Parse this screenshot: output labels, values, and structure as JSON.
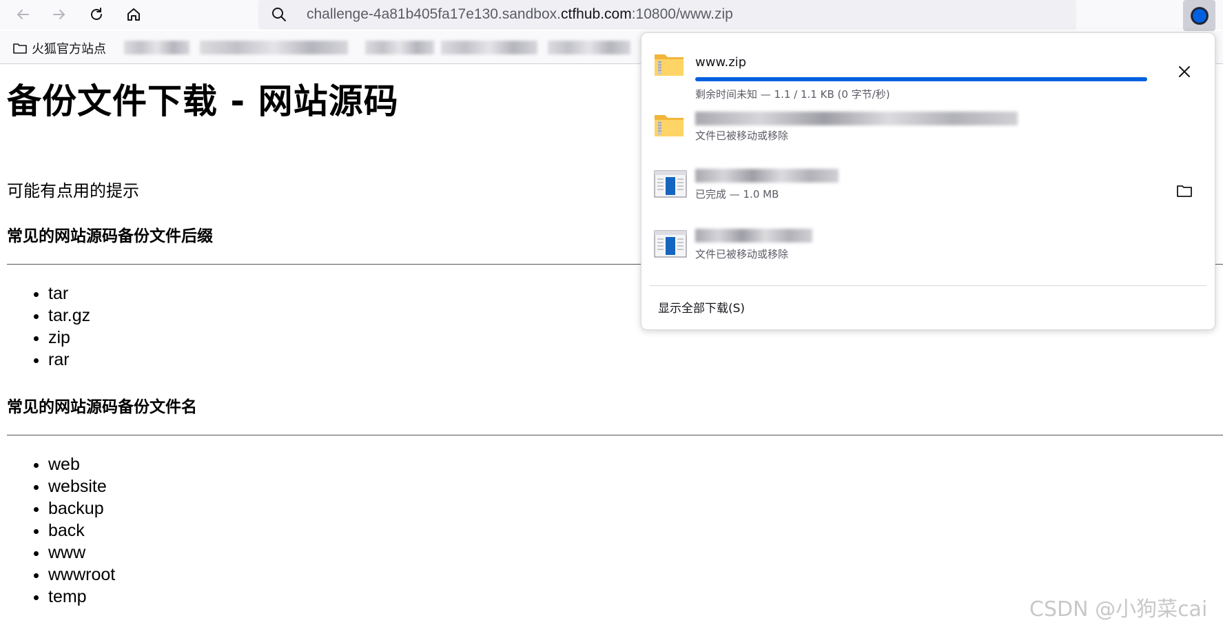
{
  "browser": {
    "url_prefix": "challenge-4a81b405fa17e130.sandbox.",
    "url_domain": "ctfhub.com",
    "url_suffix": ":10800/www.zip",
    "bookmark_folder_label": "火狐官方站点"
  },
  "page": {
    "title": "备份文件下载 - 网站源码",
    "hint": "可能有点用的提示",
    "section1_title": "常见的网站源码备份文件后缀",
    "suffixes": [
      "tar",
      "tar.gz",
      "zip",
      "rar"
    ],
    "section2_title": "常见的网站源码备份文件名",
    "names": [
      "web",
      "website",
      "backup",
      "back",
      "www",
      "wwwroot",
      "temp"
    ]
  },
  "downloads": {
    "items": [
      {
        "name": "www.zip",
        "status": "剩余时间未知 — 1.1 / 1.1 KB (0 字节/秒)",
        "progress": 1.0,
        "icon": "zip-folder-icon",
        "action": "close-icon"
      },
      {
        "name": "",
        "status": "文件已被移动或移除",
        "icon": "zip-folder-icon"
      },
      {
        "name": "",
        "status": "已完成 — 1.0 MB",
        "icon": "installer-icon",
        "action": "folder-icon"
      },
      {
        "name": "",
        "status": "文件已被移动或移除",
        "icon": "installer-icon"
      }
    ],
    "show_all_label": "显示全部下载(S)"
  },
  "watermark": "CSDN @小狗菜cai",
  "colors": {
    "accent": "#0060df",
    "toolbar_bg": "#f9f9fb",
    "urlbar_bg": "#f0f0f4"
  }
}
